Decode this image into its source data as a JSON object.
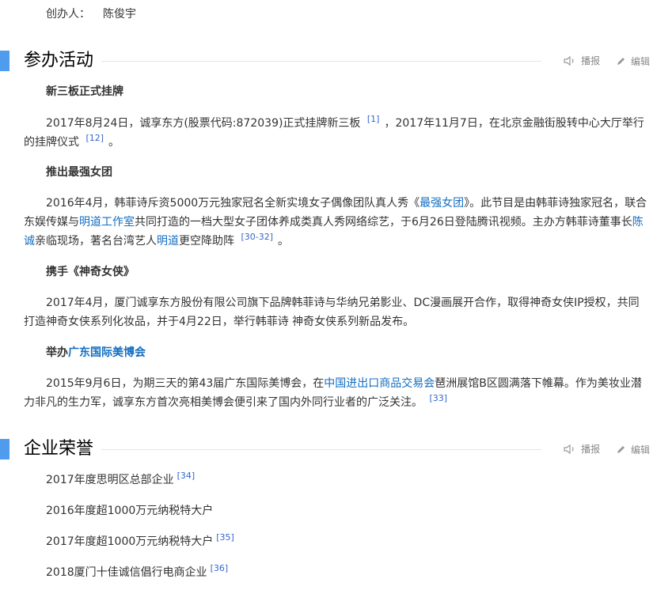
{
  "founder": {
    "label": "创办人：",
    "value": "陈俊宇"
  },
  "sections": {
    "activities": {
      "title": "参办活动",
      "play_label": "播报",
      "edit_label": "编辑"
    },
    "honors": {
      "title": "企业荣誉",
      "play_label": "播报",
      "edit_label": "编辑"
    }
  },
  "activities": [
    {
      "heading": "新三板正式挂牌",
      "para": [
        {
          "t": "2017年8月24日，诚享东方(股票代码:872039)正式挂牌新三板 "
        },
        {
          "ref": "[1]"
        },
        {
          "t": "，2017年11月7日，在北京金融街股转中心大厅举行的挂牌仪式 "
        },
        {
          "ref": "[12]"
        },
        {
          "t": "。"
        }
      ]
    },
    {
      "heading": "推出最强女团",
      "para": [
        {
          "t": "2016年4月，韩菲诗斥资5000万元独家冠名全新实境女子偶像团队真人秀《"
        },
        {
          "link": "最强女团"
        },
        {
          "t": "》。此节目是由韩菲诗独家冠名，联合东娱传媒与"
        },
        {
          "link": "明道工作室"
        },
        {
          "t": "共同打造的一档大型女子团体养成类真人秀网络综艺，于6月26日登陆腾讯视频。主办方韩菲诗董事长"
        },
        {
          "link": "陈诚"
        },
        {
          "t": "亲临现场，著名台湾艺人"
        },
        {
          "link": "明道"
        },
        {
          "t": "更空降助阵 "
        },
        {
          "ref": "[30-32]"
        },
        {
          "t": "。"
        }
      ]
    },
    {
      "heading": "携手《神奇女侠》",
      "para": [
        {
          "t": "2017年4月，厦门诚享东方股份有限公司旗下品牌韩菲诗与华纳兄弟影业、DC漫画展开合作，取得神奇女侠IP授权，共同打造神奇女侠系列化妆品，并于4月22日，举行韩菲诗 神奇女侠系列新品发布。"
        }
      ]
    },
    {
      "heading_prefix": "举办",
      "heading_link": "广东国际美博会",
      "para": [
        {
          "t": "2015年9月6日，为期三天的第43届广东国际美博会，在"
        },
        {
          "link": "中国进出口商品交易会"
        },
        {
          "t": "琶洲展馆B区圆满落下帷幕。作为美妆业潜力非凡的生力军，诚享东方首次亮相美博会便引来了国内外同行业者的广泛关注。 "
        },
        {
          "ref": "[33]"
        }
      ]
    }
  ],
  "honors": [
    {
      "text": "2017年度思明区总部企业",
      "ref": "[34]"
    },
    {
      "text": "2016年度超1000万元纳税特大户",
      "ref": ""
    },
    {
      "text": "2017年度超1000万元纳税特大户",
      "ref": "[35]"
    },
    {
      "text": "2018厦门十佳诚信倡行电商企业",
      "ref": "[36]"
    }
  ],
  "colors": {
    "accent": "#4f9cee",
    "link": "#136ec2",
    "ref": "#3366cc"
  },
  "icons": {
    "play": "speaker-icon",
    "edit": "pencil-icon"
  }
}
